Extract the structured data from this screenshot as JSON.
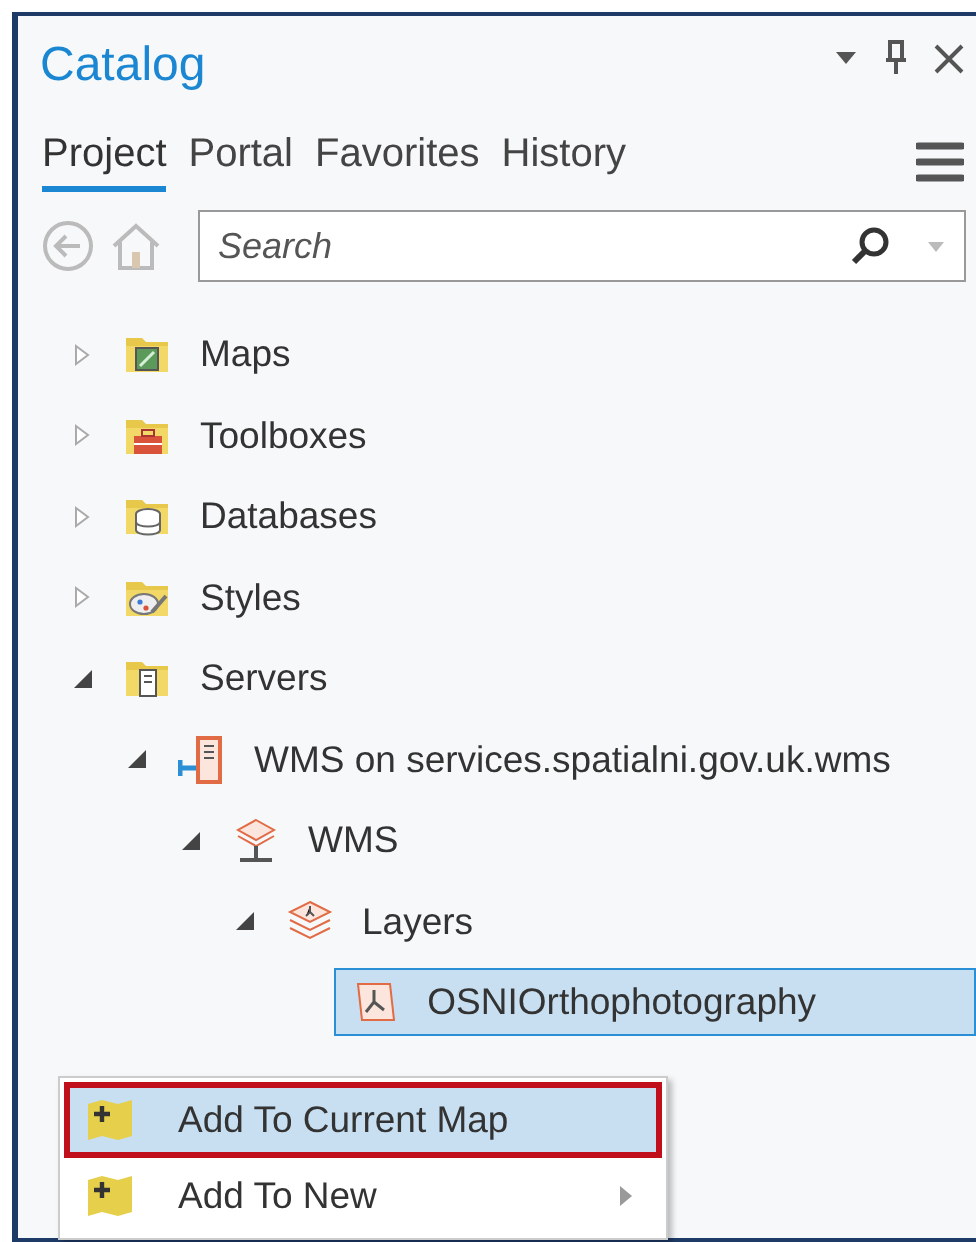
{
  "pane": {
    "title": "Catalog"
  },
  "tabs": [
    {
      "label": "Project",
      "selected": true
    },
    {
      "label": "Portal",
      "selected": false
    },
    {
      "label": "Favorites",
      "selected": false
    },
    {
      "label": "History",
      "selected": false
    }
  ],
  "search": {
    "placeholder": "Search"
  },
  "tree": [
    {
      "label": "Maps",
      "kind": "maps",
      "expanded": false,
      "selected": false
    },
    {
      "label": "Toolboxes",
      "kind": "toolboxes",
      "expanded": false,
      "selected": false
    },
    {
      "label": "Databases",
      "kind": "databases",
      "expanded": false,
      "selected": false
    },
    {
      "label": "Styles",
      "kind": "styles",
      "expanded": false,
      "selected": false
    },
    {
      "label": "Servers",
      "kind": "servers",
      "expanded": true,
      "selected": false,
      "children": [
        {
          "label": "WMS on services.spatialni.gov.uk.wms",
          "kind": "wms-server",
          "expanded": true,
          "selected": false,
          "children": [
            {
              "label": "WMS",
              "kind": "service",
              "expanded": true,
              "selected": false,
              "children": [
                {
                  "label": "Layers",
                  "kind": "layers",
                  "expanded": true,
                  "selected": false,
                  "children": [
                    {
                      "label": "OSNIOrthophotography",
                      "kind": "layer",
                      "selected": true
                    }
                  ]
                }
              ]
            }
          ]
        }
      ]
    }
  ],
  "context_menu": [
    {
      "label": "Add To Current Map",
      "selected": true,
      "submenu": false
    },
    {
      "label": "Add To New",
      "selected": false,
      "submenu": true
    }
  ]
}
